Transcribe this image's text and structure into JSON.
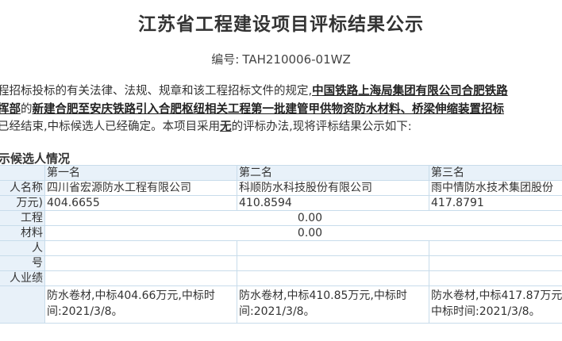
{
  "title": "江苏省工程建设项目评标结果公示",
  "serial_label": "编号:",
  "serial_no": "TAH210006-01WZ",
  "intro": {
    "line1_a": "程招标投标的有关法律、法规、规章和该工程招标文件的规定,",
    "line1_b": "中国铁路上海局集团有限公司合肥铁路",
    "line2_a": "挥部",
    "line2_b": "的",
    "line2_c": "新建合肥至安庆铁路引入合肥枢纽相关工程第一批建管甲供物资防水材料、桥梁伸缩装置招标",
    "line3_a": "已经结束,中标候选人已经确定。本项目采用",
    "line3_b": "无",
    "line3_c": "的评标办法,现将评标结果公示如下:"
  },
  "section_title": "示候选人情况",
  "table": {
    "headers": [
      "",
      "第一名",
      "第二名",
      "第三名"
    ],
    "rows": [
      {
        "label": "人名称",
        "values": [
          "四川省宏源防水工程有限公司",
          "科顺防水科技股份有限公司",
          "雨中情防水技术集团股份"
        ]
      },
      {
        "label": "万元)",
        "values": [
          "404.6655",
          "410.8594",
          "417.8791"
        ]
      },
      {
        "label": "工程",
        "merged": "0.00"
      },
      {
        "label": "材料",
        "merged": "0.00"
      },
      {
        "label": "人",
        "values": [
          "",
          "",
          ""
        ]
      },
      {
        "label": "号",
        "values": [
          "",
          "",
          ""
        ]
      },
      {
        "label": "人业绩",
        "values": [
          "",
          "",
          ""
        ]
      },
      {
        "label": "",
        "values": [
          "防水卷材,中标404.66万元,中标时间:2021/3/8。",
          "防水卷材,中标410.85万元,中标时间:2021/3/8。",
          "防水卷材,中标417.87万元,中标时间:2021/3/8。"
        ]
      }
    ]
  }
}
